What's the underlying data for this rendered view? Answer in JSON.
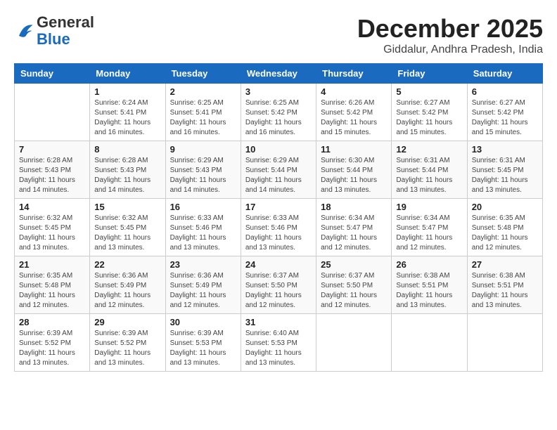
{
  "logo": {
    "general": "General",
    "blue": "Blue"
  },
  "title": "December 2025",
  "subtitle": "Giddalur, Andhra Pradesh, India",
  "weekdays": [
    "Sunday",
    "Monday",
    "Tuesday",
    "Wednesday",
    "Thursday",
    "Friday",
    "Saturday"
  ],
  "weeks": [
    [
      {
        "day": "",
        "sunrise": "",
        "sunset": "",
        "daylight": ""
      },
      {
        "day": "1",
        "sunrise": "Sunrise: 6:24 AM",
        "sunset": "Sunset: 5:41 PM",
        "daylight": "Daylight: 11 hours and 16 minutes."
      },
      {
        "day": "2",
        "sunrise": "Sunrise: 6:25 AM",
        "sunset": "Sunset: 5:41 PM",
        "daylight": "Daylight: 11 hours and 16 minutes."
      },
      {
        "day": "3",
        "sunrise": "Sunrise: 6:25 AM",
        "sunset": "Sunset: 5:42 PM",
        "daylight": "Daylight: 11 hours and 16 minutes."
      },
      {
        "day": "4",
        "sunrise": "Sunrise: 6:26 AM",
        "sunset": "Sunset: 5:42 PM",
        "daylight": "Daylight: 11 hours and 15 minutes."
      },
      {
        "day": "5",
        "sunrise": "Sunrise: 6:27 AM",
        "sunset": "Sunset: 5:42 PM",
        "daylight": "Daylight: 11 hours and 15 minutes."
      },
      {
        "day": "6",
        "sunrise": "Sunrise: 6:27 AM",
        "sunset": "Sunset: 5:42 PM",
        "daylight": "Daylight: 11 hours and 15 minutes."
      }
    ],
    [
      {
        "day": "7",
        "sunrise": "Sunrise: 6:28 AM",
        "sunset": "Sunset: 5:43 PM",
        "daylight": "Daylight: 11 hours and 14 minutes."
      },
      {
        "day": "8",
        "sunrise": "Sunrise: 6:28 AM",
        "sunset": "Sunset: 5:43 PM",
        "daylight": "Daylight: 11 hours and 14 minutes."
      },
      {
        "day": "9",
        "sunrise": "Sunrise: 6:29 AM",
        "sunset": "Sunset: 5:43 PM",
        "daylight": "Daylight: 11 hours and 14 minutes."
      },
      {
        "day": "10",
        "sunrise": "Sunrise: 6:29 AM",
        "sunset": "Sunset: 5:44 PM",
        "daylight": "Daylight: 11 hours and 14 minutes."
      },
      {
        "day": "11",
        "sunrise": "Sunrise: 6:30 AM",
        "sunset": "Sunset: 5:44 PM",
        "daylight": "Daylight: 11 hours and 13 minutes."
      },
      {
        "day": "12",
        "sunrise": "Sunrise: 6:31 AM",
        "sunset": "Sunset: 5:44 PM",
        "daylight": "Daylight: 11 hours and 13 minutes."
      },
      {
        "day": "13",
        "sunrise": "Sunrise: 6:31 AM",
        "sunset": "Sunset: 5:45 PM",
        "daylight": "Daylight: 11 hours and 13 minutes."
      }
    ],
    [
      {
        "day": "14",
        "sunrise": "Sunrise: 6:32 AM",
        "sunset": "Sunset: 5:45 PM",
        "daylight": "Daylight: 11 hours and 13 minutes."
      },
      {
        "day": "15",
        "sunrise": "Sunrise: 6:32 AM",
        "sunset": "Sunset: 5:45 PM",
        "daylight": "Daylight: 11 hours and 13 minutes."
      },
      {
        "day": "16",
        "sunrise": "Sunrise: 6:33 AM",
        "sunset": "Sunset: 5:46 PM",
        "daylight": "Daylight: 11 hours and 13 minutes."
      },
      {
        "day": "17",
        "sunrise": "Sunrise: 6:33 AM",
        "sunset": "Sunset: 5:46 PM",
        "daylight": "Daylight: 11 hours and 13 minutes."
      },
      {
        "day": "18",
        "sunrise": "Sunrise: 6:34 AM",
        "sunset": "Sunset: 5:47 PM",
        "daylight": "Daylight: 11 hours and 12 minutes."
      },
      {
        "day": "19",
        "sunrise": "Sunrise: 6:34 AM",
        "sunset": "Sunset: 5:47 PM",
        "daylight": "Daylight: 11 hours and 12 minutes."
      },
      {
        "day": "20",
        "sunrise": "Sunrise: 6:35 AM",
        "sunset": "Sunset: 5:48 PM",
        "daylight": "Daylight: 11 hours and 12 minutes."
      }
    ],
    [
      {
        "day": "21",
        "sunrise": "Sunrise: 6:35 AM",
        "sunset": "Sunset: 5:48 PM",
        "daylight": "Daylight: 11 hours and 12 minutes."
      },
      {
        "day": "22",
        "sunrise": "Sunrise: 6:36 AM",
        "sunset": "Sunset: 5:49 PM",
        "daylight": "Daylight: 11 hours and 12 minutes."
      },
      {
        "day": "23",
        "sunrise": "Sunrise: 6:36 AM",
        "sunset": "Sunset: 5:49 PM",
        "daylight": "Daylight: 11 hours and 12 minutes."
      },
      {
        "day": "24",
        "sunrise": "Sunrise: 6:37 AM",
        "sunset": "Sunset: 5:50 PM",
        "daylight": "Daylight: 11 hours and 12 minutes."
      },
      {
        "day": "25",
        "sunrise": "Sunrise: 6:37 AM",
        "sunset": "Sunset: 5:50 PM",
        "daylight": "Daylight: 11 hours and 12 minutes."
      },
      {
        "day": "26",
        "sunrise": "Sunrise: 6:38 AM",
        "sunset": "Sunset: 5:51 PM",
        "daylight": "Daylight: 11 hours and 13 minutes."
      },
      {
        "day": "27",
        "sunrise": "Sunrise: 6:38 AM",
        "sunset": "Sunset: 5:51 PM",
        "daylight": "Daylight: 11 hours and 13 minutes."
      }
    ],
    [
      {
        "day": "28",
        "sunrise": "Sunrise: 6:39 AM",
        "sunset": "Sunset: 5:52 PM",
        "daylight": "Daylight: 11 hours and 13 minutes."
      },
      {
        "day": "29",
        "sunrise": "Sunrise: 6:39 AM",
        "sunset": "Sunset: 5:52 PM",
        "daylight": "Daylight: 11 hours and 13 minutes."
      },
      {
        "day": "30",
        "sunrise": "Sunrise: 6:39 AM",
        "sunset": "Sunset: 5:53 PM",
        "daylight": "Daylight: 11 hours and 13 minutes."
      },
      {
        "day": "31",
        "sunrise": "Sunrise: 6:40 AM",
        "sunset": "Sunset: 5:53 PM",
        "daylight": "Daylight: 11 hours and 13 minutes."
      },
      {
        "day": "",
        "sunrise": "",
        "sunset": "",
        "daylight": ""
      },
      {
        "day": "",
        "sunrise": "",
        "sunset": "",
        "daylight": ""
      },
      {
        "day": "",
        "sunrise": "",
        "sunset": "",
        "daylight": ""
      }
    ]
  ]
}
